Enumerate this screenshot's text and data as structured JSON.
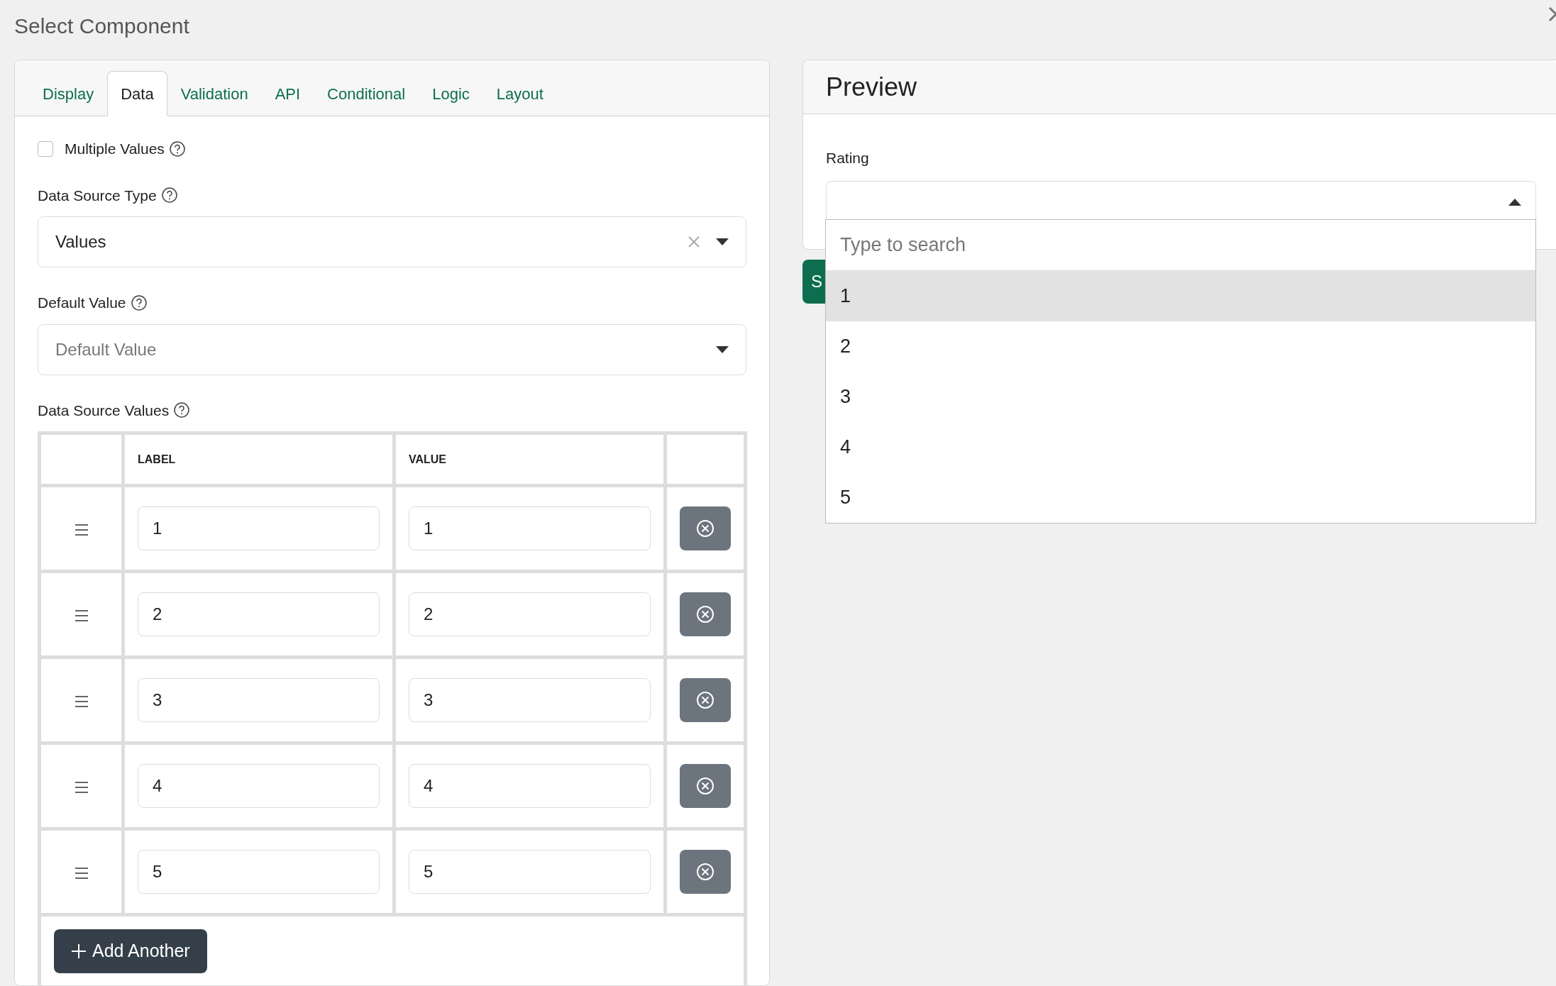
{
  "dialog": {
    "title": "Select Component"
  },
  "tabs": [
    {
      "label": "Display",
      "selected": false
    },
    {
      "label": "Data",
      "selected": true
    },
    {
      "label": "Validation",
      "selected": false
    },
    {
      "label": "API",
      "selected": false
    },
    {
      "label": "Conditional",
      "selected": false
    },
    {
      "label": "Logic",
      "selected": false
    },
    {
      "label": "Layout",
      "selected": false
    }
  ],
  "multiple_values": {
    "label": "Multiple Values",
    "checked": false
  },
  "data_source_type": {
    "label": "Data Source Type",
    "value": "Values"
  },
  "default_value": {
    "label": "Default Value",
    "placeholder": "Default Value"
  },
  "data_source_values": {
    "label": "Data Source Values",
    "columns": [
      "LABEL",
      "VALUE"
    ],
    "rows": [
      {
        "label": "1",
        "value": "1"
      },
      {
        "label": "2",
        "value": "2"
      },
      {
        "label": "3",
        "value": "3"
      },
      {
        "label": "4",
        "value": "4"
      },
      {
        "label": "5",
        "value": "5"
      }
    ],
    "add_button": "Add Another"
  },
  "preview": {
    "title": "Preview",
    "field_label": "Rating",
    "expanded": true,
    "search_placeholder": "Type to search",
    "options": [
      {
        "label": "1",
        "selected": true
      },
      {
        "label": "2",
        "selected": false
      },
      {
        "label": "3",
        "selected": false
      },
      {
        "label": "4",
        "selected": false
      },
      {
        "label": "5",
        "selected": false
      }
    ],
    "submit_button": "S"
  }
}
